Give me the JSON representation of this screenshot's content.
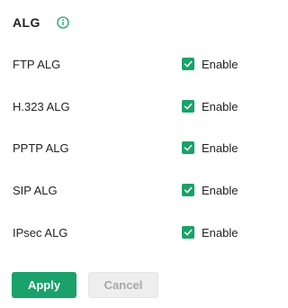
{
  "section": {
    "title": "ALG",
    "info_icon": "info-circle-icon"
  },
  "items": [
    {
      "label": "FTP ALG",
      "enable_label": "Enable",
      "checked": true
    },
    {
      "label": "H.323 ALG",
      "enable_label": "Enable",
      "checked": true
    },
    {
      "label": "PPTP ALG",
      "enable_label": "Enable",
      "checked": true
    },
    {
      "label": "SIP ALG",
      "enable_label": "Enable",
      "checked": true
    },
    {
      "label": "IPsec ALG",
      "enable_label": "Enable",
      "checked": true
    }
  ],
  "buttons": {
    "apply_label": "Apply",
    "cancel_label": "Cancel"
  },
  "colors": {
    "accent": "#1aa26a",
    "disabled_bg": "#eeeeee",
    "disabled_text": "#a8a8a8"
  }
}
